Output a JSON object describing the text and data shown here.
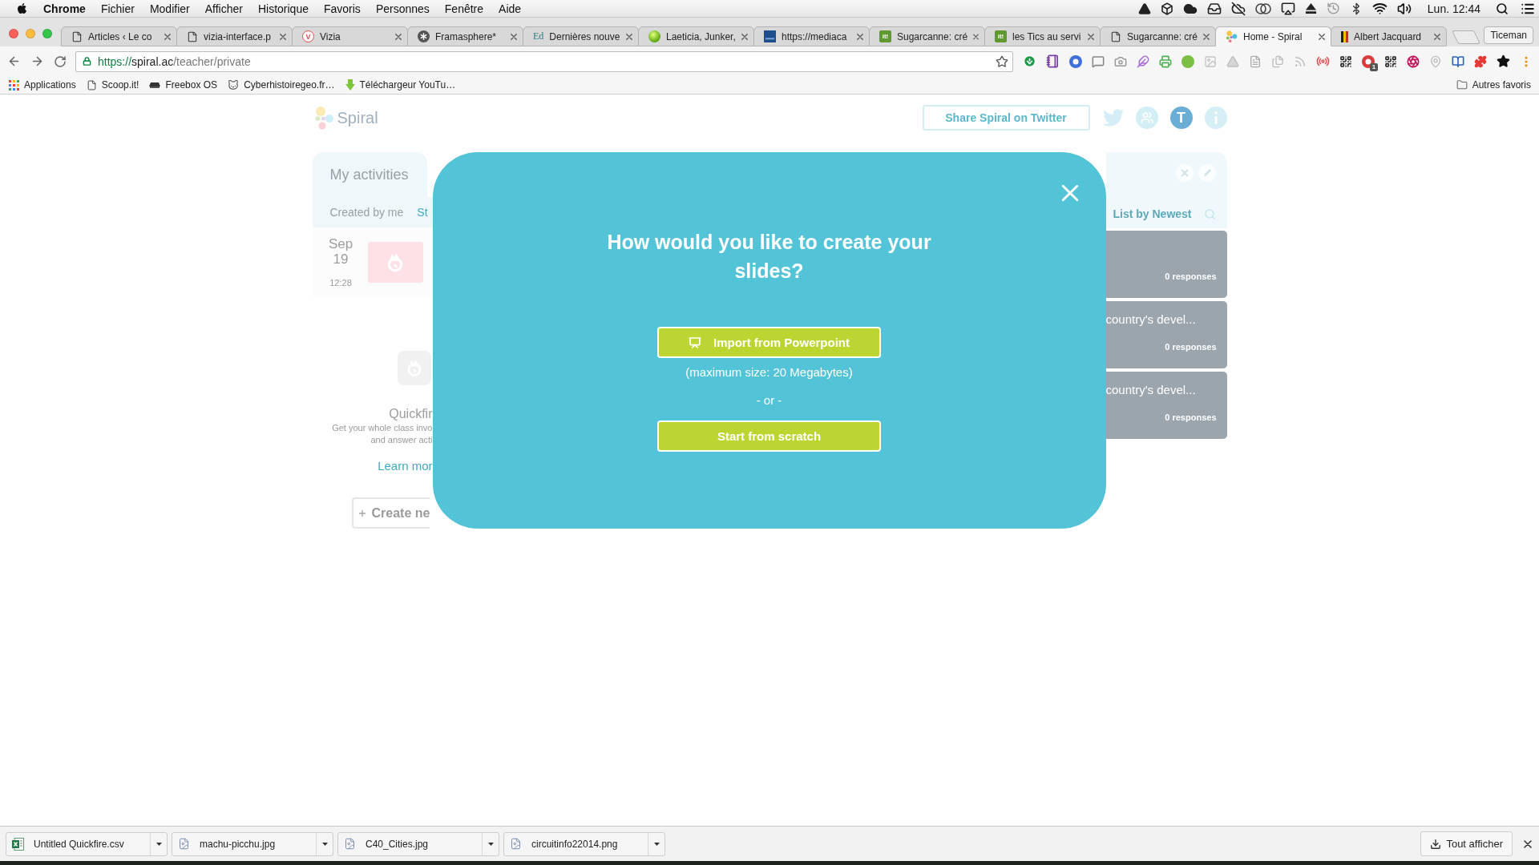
{
  "menu_bar": {
    "app": "Chrome",
    "items": [
      "Fichier",
      "Modifier",
      "Afficher",
      "Historique",
      "Favoris",
      "Personnes",
      "Fenêtre",
      "Aide"
    ],
    "clock": "Lun. 12:44"
  },
  "tabs": [
    {
      "title": "Articles ‹ Le co",
      "kind": "page",
      "selected": false
    },
    {
      "title": "vizia-interface.p",
      "kind": "page",
      "selected": false
    },
    {
      "title": "Vizia",
      "kind": "circle-letter",
      "icon_text": "V",
      "selected": false
    },
    {
      "title": "Framasphere*",
      "kind": "asterisk",
      "selected": false
    },
    {
      "title": "Dernières nouve",
      "kind": "letters",
      "icon_text": "Ed",
      "selected": false
    },
    {
      "title": "Laeticia, Junker,",
      "kind": "ball",
      "selected": false
    },
    {
      "title": "https://mediaca",
      "kind": "tile",
      "selected": false
    },
    {
      "title": "Sugarcanne: cré",
      "kind": "square-letters",
      "icon_text": "it!",
      "selected": false
    },
    {
      "title": "les Tics au servi",
      "kind": "square-letters",
      "icon_text": "it!",
      "selected": false
    },
    {
      "title": "Sugarcanne: cré",
      "kind": "page",
      "selected": false
    },
    {
      "title": "Home - Spiral",
      "kind": "dots",
      "selected": true
    },
    {
      "title": "Albert Jacquard",
      "kind": "flag",
      "selected": false
    }
  ],
  "profile_button": "Ticeman",
  "address_bar": {
    "scheme": "https://",
    "host": "spiral.ac",
    "path": "/teacher/private"
  },
  "extension_badge": "1",
  "bookmarks": [
    {
      "label": "Applications",
      "kind": "grid"
    },
    {
      "label": "Scoop.it!",
      "kind": "page"
    },
    {
      "label": "Freebox OS",
      "kind": "router"
    },
    {
      "label": "Cyberhistoiregeo.fr…",
      "kind": "cat"
    },
    {
      "label": "Téléchargeur YouTu…",
      "kind": "arrow"
    }
  ],
  "other_bookmarks": "Autres favoris",
  "page": {
    "logo": "Spiral",
    "share_button": "Share Spiral on Twitter",
    "avatar": "T",
    "activities": {
      "tab": "My activities",
      "filters": [
        {
          "label": "Created by me",
          "selected": true
        },
        {
          "label": "St",
          "selected": false
        }
      ],
      "activity": {
        "month": "Sep",
        "day": "19",
        "time": "12:28"
      }
    },
    "quickfire": {
      "title": "Quickfir",
      "description": [
        "Get your whole class invo",
        "and answer acti"
      ],
      "link": "Learn mor",
      "create_button": "Create ne"
    },
    "list": {
      "sort": "List by Newest",
      "cards": [
        {
          "responses": "0 responses"
        },
        {
          "title": "country's devel...",
          "responses": "0 responses"
        },
        {
          "title": "country's devel...",
          "responses": "0 responses"
        }
      ]
    }
  },
  "modal": {
    "title": "How would you like to create your slides?",
    "import_button": "Import from Powerpoint",
    "size_note": "(maximum size: 20 Megabytes)",
    "separator": "- or -",
    "start_button": "Start from scratch"
  },
  "downloads": {
    "items": [
      {
        "file": "Untitled Quickfire.csv",
        "kind": "spreadsheet"
      },
      {
        "file": "machu-picchu.jpg",
        "kind": "image"
      },
      {
        "file": "C40_Cities.jpg",
        "kind": "image"
      },
      {
        "file": "circuitinfo22014.png",
        "kind": "image"
      }
    ],
    "show_all": "Tout afficher"
  }
}
